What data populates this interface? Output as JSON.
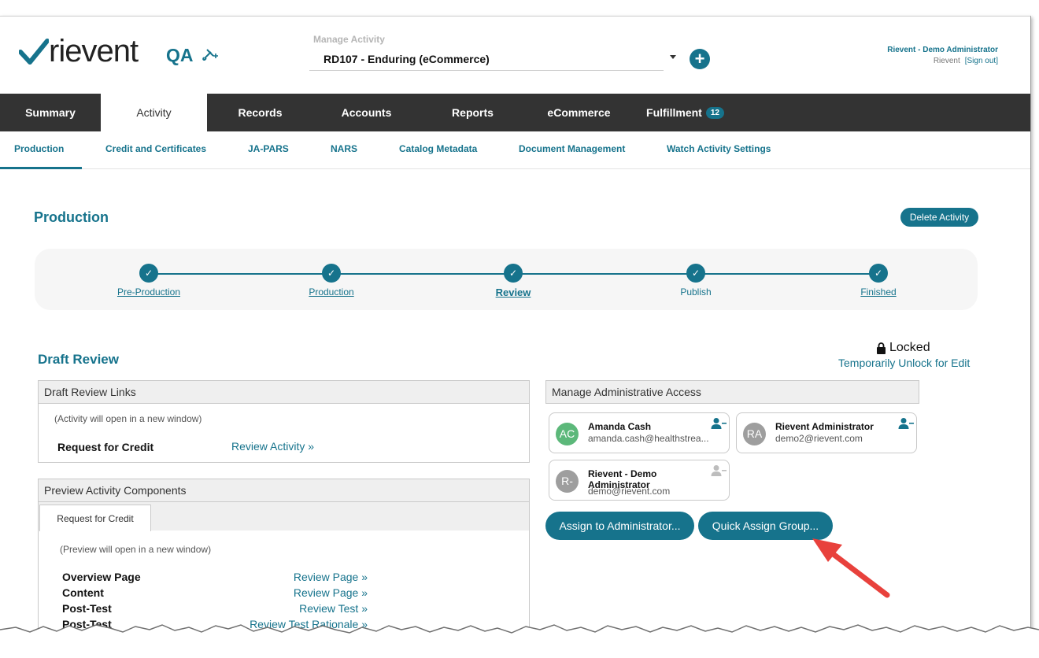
{
  "brand": {
    "logo_text": "rievent",
    "environment": "QA"
  },
  "manage_activity": {
    "label": "Manage Activity",
    "selected": "RD107 - Enduring (eCommerce)"
  },
  "user": {
    "name": "Rievent - Demo Administrator",
    "org": "Rievent",
    "sign_out": "[Sign out]"
  },
  "main_tabs": [
    {
      "label": "Summary"
    },
    {
      "label": "Activity"
    },
    {
      "label": "Records"
    },
    {
      "label": "Accounts"
    },
    {
      "label": "Reports"
    },
    {
      "label": "eCommerce"
    },
    {
      "label": "Fulfillment",
      "badge": "12"
    }
  ],
  "sub_tabs": [
    {
      "label": "Production"
    },
    {
      "label": "Credit and Certificates"
    },
    {
      "label": "JA-PARS"
    },
    {
      "label": "NARS"
    },
    {
      "label": "Catalog Metadata"
    },
    {
      "label": "Document Management"
    },
    {
      "label": "Watch Activity Settings"
    }
  ],
  "production": {
    "title": "Production",
    "delete_label": "Delete Activity",
    "steps": [
      {
        "label": "Pre-Production"
      },
      {
        "label": "Production"
      },
      {
        "label": "Review"
      },
      {
        "label": "Publish"
      },
      {
        "label": "Finished"
      }
    ]
  },
  "draft_review": {
    "title": "Draft Review",
    "locked_label": "Locked",
    "unlock_label": "Temporarily Unlock for Edit",
    "links_panel": {
      "title": "Draft Review Links",
      "note": "(Activity will open in a new window)",
      "row_label": "Request for Credit",
      "row_link": "Review Activity »"
    },
    "preview_panel": {
      "title": "Preview Activity Components",
      "tab": "Request for Credit",
      "note": "(Preview will open in a new window)",
      "rows": [
        {
          "label": "Overview Page",
          "link": "Review Page »"
        },
        {
          "label": "Content",
          "link": "Review Page »"
        },
        {
          "label": "Post-Test",
          "link": "Review Test »"
        },
        {
          "label": "Post-Test",
          "link": "Review Test Rationale »"
        }
      ]
    }
  },
  "admin_access": {
    "title": "Manage Administrative Access",
    "admins": [
      {
        "initials": "AC",
        "name": "Amanda Cash",
        "email": "amanda.cash@healthstrea...",
        "color": "#5cb87a"
      },
      {
        "initials": "RA",
        "name": "Rievent Administrator",
        "email": "demo2@rievent.com",
        "color": "#9e9e9e"
      },
      {
        "initials": "R-",
        "name": "Rievent - Demo Administrator",
        "email": "demo@rievent.com",
        "color": "#9e9e9e"
      }
    ],
    "assign_label": "Assign to Administrator...",
    "quick_assign_label": "Quick Assign Group..."
  },
  "colors": {
    "accent": "#16738c",
    "nav_bg": "#333333",
    "annotation_arrow": "#e8413c"
  }
}
